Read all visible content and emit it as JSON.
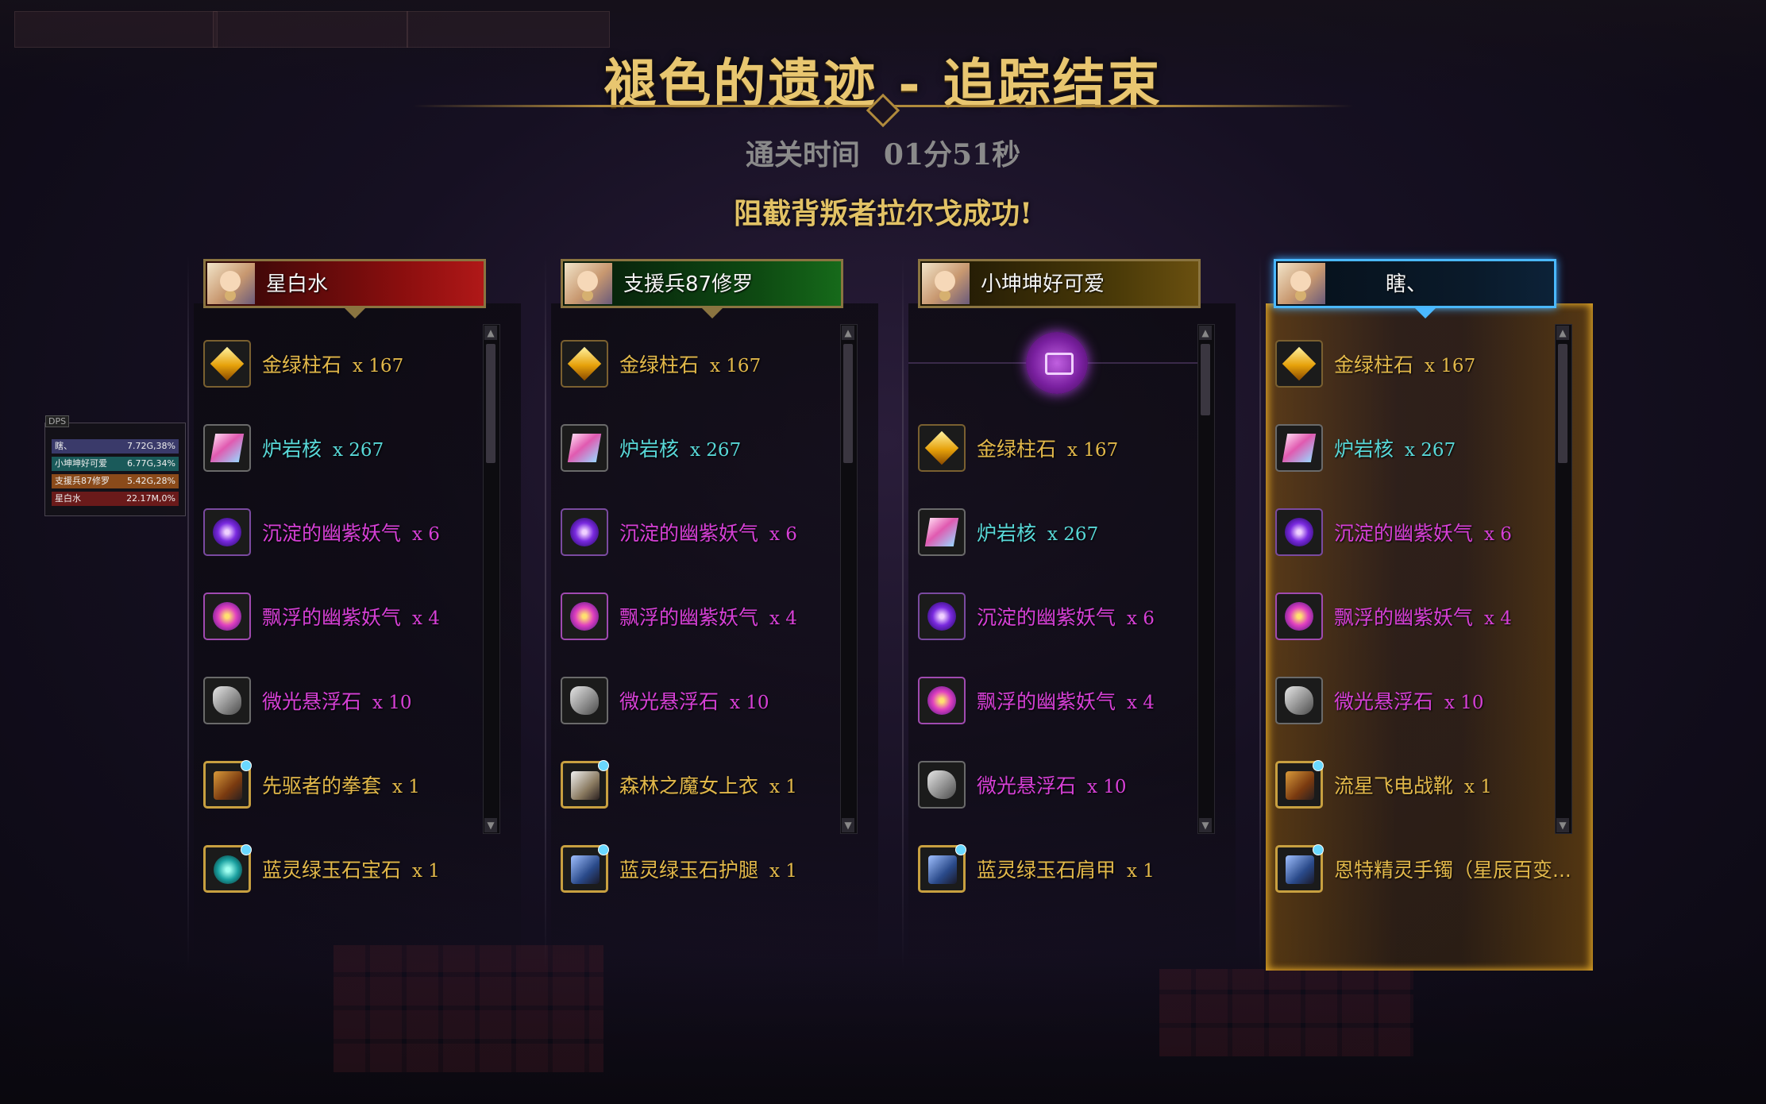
{
  "title": "褪色的遗迹 - 追踪结束",
  "clear_time": {
    "label": "通关时间",
    "value": "01分51秒"
  },
  "success_message": "阻截背叛者拉尔戈成功!",
  "dps_meter": {
    "header": "DPS",
    "rows": [
      {
        "name": "瞎、",
        "value": "7.72G,38%",
        "color": "#3a3a6a"
      },
      {
        "name": "小坤坤好可爱",
        "value": "6.77G,34%",
        "color": "#1a5a5a"
      },
      {
        "name": "支援兵87修罗",
        "value": "5.42G,28%",
        "color": "#8a4a1a"
      },
      {
        "name": "星白水",
        "value": "22.17M,0%",
        "color": "#6a1a1a"
      }
    ]
  },
  "players": [
    {
      "name": "星白水",
      "theme": "red",
      "items": [
        {
          "name": "金绿柱石",
          "qty": "x 167",
          "icon": "gold-gem-icon",
          "color": "gold"
        },
        {
          "name": "炉岩核",
          "qty": "x 267",
          "icon": "crystal-icon",
          "color": "cyan"
        },
        {
          "name": "沉淀的幽紫妖气",
          "qty": "x 6",
          "icon": "purple-orb-icon",
          "color": "magenta"
        },
        {
          "name": "飘浮的幽紫妖气",
          "qty": "x 4",
          "icon": "pink-orb-icon",
          "color": "magenta"
        },
        {
          "name": "微光悬浮石",
          "qty": "x 10",
          "icon": "stone-icon",
          "color": "magenta"
        },
        {
          "name": "先驱者的拳套",
          "qty": "x 1",
          "icon": "gauntlet-icon",
          "color": "gold"
        },
        {
          "name": "蓝灵绿玉石宝石",
          "qty": "x 1",
          "icon": "gem-stone-icon",
          "color": "gold"
        }
      ]
    },
    {
      "name": "支援兵87修罗",
      "theme": "green",
      "items": [
        {
          "name": "金绿柱石",
          "qty": "x 167",
          "icon": "gold-gem-icon",
          "color": "gold"
        },
        {
          "name": "炉岩核",
          "qty": "x 267",
          "icon": "crystal-icon",
          "color": "cyan"
        },
        {
          "name": "沉淀的幽紫妖气",
          "qty": "x 6",
          "icon": "purple-orb-icon",
          "color": "magenta"
        },
        {
          "name": "飘浮的幽紫妖气",
          "qty": "x 4",
          "icon": "pink-orb-icon",
          "color": "magenta"
        },
        {
          "name": "微光悬浮石",
          "qty": "x 10",
          "icon": "stone-icon",
          "color": "magenta"
        },
        {
          "name": "森林之魔女上衣",
          "qty": "x 1",
          "icon": "robe-icon",
          "color": "gold"
        },
        {
          "name": "蓝灵绿玉石护腿",
          "qty": "x 1",
          "icon": "leg-armor-icon",
          "color": "gold"
        }
      ]
    },
    {
      "name": "小坤坤好可爱",
      "theme": "gold",
      "chest_icon": "chest-icon",
      "items": [
        {
          "name": "金绿柱石",
          "qty": "x 167",
          "icon": "gold-gem-icon",
          "color": "gold"
        },
        {
          "name": "炉岩核",
          "qty": "x 267",
          "icon": "crystal-icon",
          "color": "cyan"
        },
        {
          "name": "沉淀的幽紫妖气",
          "qty": "x 6",
          "icon": "purple-orb-icon",
          "color": "magenta"
        },
        {
          "name": "飘浮的幽紫妖气",
          "qty": "x 4",
          "icon": "pink-orb-icon",
          "color": "magenta"
        },
        {
          "name": "微光悬浮石",
          "qty": "x 10",
          "icon": "stone-icon",
          "color": "magenta"
        },
        {
          "name": "蓝灵绿玉石肩甲",
          "qty": "x 1",
          "icon": "shoulder-armor-icon",
          "color": "gold"
        }
      ]
    },
    {
      "name": "瞎、",
      "theme": "blue",
      "highlight": true,
      "items": [
        {
          "name": "金绿柱石",
          "qty": "x 167",
          "icon": "gold-gem-icon",
          "color": "gold"
        },
        {
          "name": "炉岩核",
          "qty": "x 267",
          "icon": "crystal-icon",
          "color": "cyan"
        },
        {
          "name": "沉淀的幽紫妖气",
          "qty": "x 6",
          "icon": "purple-orb-icon",
          "color": "magenta"
        },
        {
          "name": "飘浮的幽紫妖气",
          "qty": "x 4",
          "icon": "pink-orb-icon",
          "color": "magenta"
        },
        {
          "name": "微光悬浮石",
          "qty": "x 10",
          "icon": "stone-icon",
          "color": "magenta"
        },
        {
          "name": "流星飞电战靴",
          "qty": "x 1",
          "icon": "boots-icon",
          "color": "gold"
        },
        {
          "name": "恩特精灵手镯（星辰百变...",
          "qty": "",
          "icon": "bracelet-icon",
          "color": "gold"
        }
      ]
    }
  ],
  "colors": {
    "gold": "#e2b84a",
    "cyan": "#58d8d8",
    "magenta": "#d640d6",
    "title": "#e8c670"
  }
}
